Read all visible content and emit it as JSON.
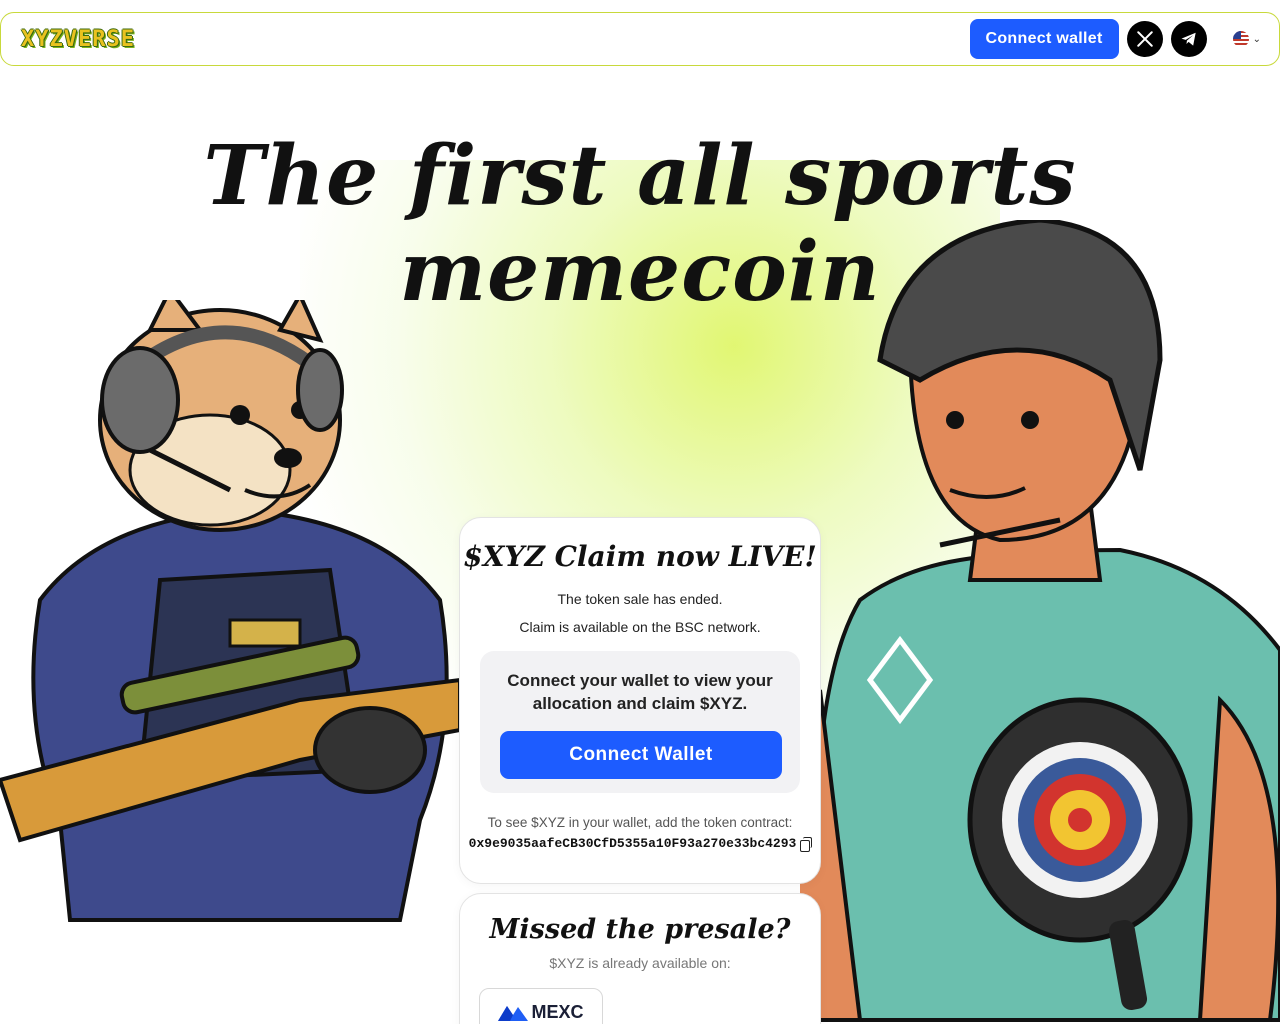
{
  "header": {
    "logo": "XYZVERSE",
    "connect_label": "Connect wallet",
    "social": [
      "x-icon",
      "telegram-icon"
    ],
    "language": "us-flag"
  },
  "hero": {
    "title": "The first all sports memecoin"
  },
  "claim_card": {
    "title": "$XYZ Claim now LIVE!",
    "line1": "The token sale has ended.",
    "line2": "Claim is available on the BSC network.",
    "prompt": "Connect your wallet to view your allocation and claim $XYZ.",
    "button": "Connect Wallet",
    "contract_note": "To see $XYZ in your wallet, add the token contract:",
    "contract": "0x9e9035aafeCB30CfD5355a10F93a270e33bc4293"
  },
  "presale_card": {
    "title": "Missed the presale?",
    "subtitle": "$XYZ is already available on:",
    "exchanges": [
      {
        "name": "MEXC"
      }
    ]
  },
  "colors": {
    "accent": "#1d5cff",
    "border": "#c8d93b",
    "glow": "#dcf55a"
  }
}
